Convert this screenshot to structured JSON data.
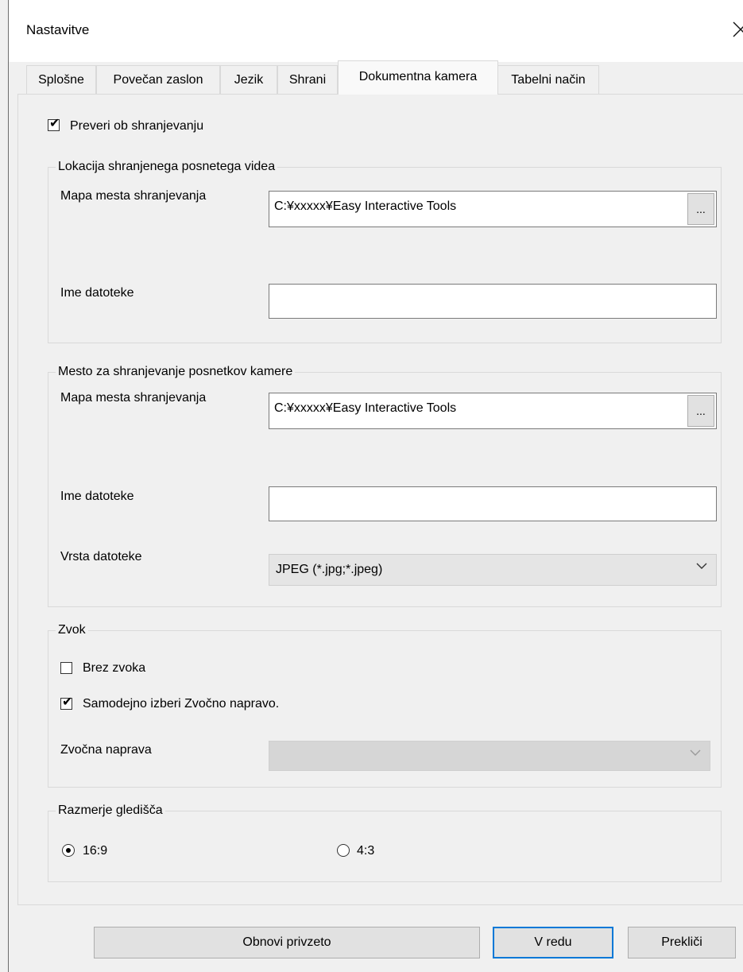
{
  "window": {
    "title": "Nastavitve",
    "close_icon": "close-icon"
  },
  "tabs": [
    {
      "label": "Splošne",
      "active": false
    },
    {
      "label": "Povečan zaslon",
      "active": false
    },
    {
      "label": "Jezik",
      "active": false
    },
    {
      "label": "Shrani",
      "active": false
    },
    {
      "label": "Dokumentna kamera",
      "active": true
    },
    {
      "label": "Tabelni način",
      "active": false
    }
  ],
  "verify": {
    "label": "Preveri ob shranjevanju",
    "checked": true
  },
  "video_group": {
    "title": "Lokacija shranjenega posnetega videa",
    "folder_label": "Mapa mesta shranjevanja",
    "folder_value": "C:¥xxxxx¥Easy Interactive Tools",
    "browse_label": "...",
    "filename_label": "Ime datoteke",
    "filename_value": ""
  },
  "camera_group": {
    "title": "Mesto za shranjevanje posnetkov kamere",
    "folder_label": "Mapa mesta shranjevanja",
    "folder_value": "C:¥xxxxx¥Easy Interactive Tools",
    "browse_label": "...",
    "filename_label": "Ime datoteke",
    "filename_value": "",
    "filetype_label": "Vrsta datoteke",
    "filetype_value": "JPEG (*.jpg;*.jpeg)"
  },
  "sound_group": {
    "title": "Zvok",
    "no_sound_label": "Brez zvoka",
    "no_sound_checked": false,
    "auto_select_label": "Samodejno izberi Zvočno napravo.",
    "auto_select_checked": true,
    "device_label": "Zvočna naprava",
    "device_value": ""
  },
  "aspect_group": {
    "title": "Razmerje gledišča",
    "options": [
      {
        "label": "16:9",
        "selected": true
      },
      {
        "label": "4:3",
        "selected": false
      }
    ]
  },
  "buttons": {
    "reset": "Obnovi privzeto",
    "ok": "V redu",
    "cancel": "Prekliči"
  },
  "colors": {
    "accent": "#0078d7"
  }
}
